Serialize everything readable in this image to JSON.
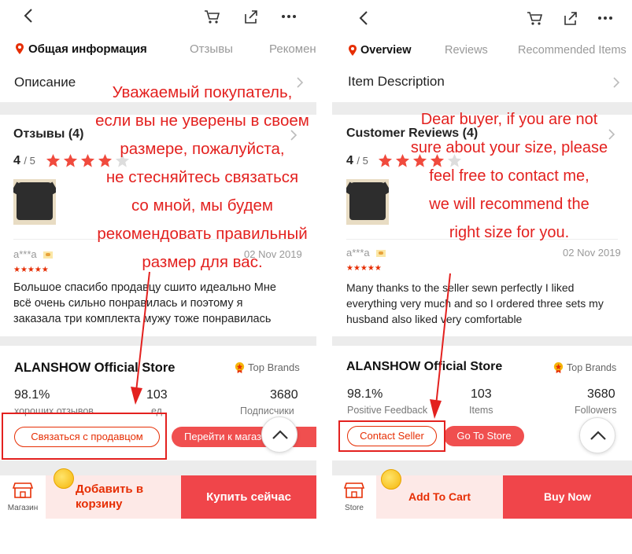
{
  "left": {
    "tabs": [
      "Общая информация",
      "Отзывы",
      "Рекомен"
    ],
    "description": "Описание",
    "reviews_title": "Отзывы (4)",
    "rating": "4",
    "rating_of": "/ 5",
    "reviewer": "a***a",
    "review_date": "02 Nov 2019",
    "review_text": [
      "Большое спасибо продавцу сшито идеально Мне",
      "всё очень сильно понравилась и поэтому я",
      "заказала три комплекта мужу тоже понравилась"
    ],
    "store_name": "ALANSHOW Official Store",
    "top_brands": "Top Brands",
    "stats": [
      {
        "value": "98.1%",
        "label": "хороших отзывов"
      },
      {
        "value": "103",
        "label": "ед."
      },
      {
        "value": "3680",
        "label": "Подписчики"
      }
    ],
    "contact_seller": "Связаться с продавцом",
    "go_to_store": "Перейти к магазину",
    "store_tab": "Магазин",
    "add_to_cart": "Добавить в корзину",
    "buy_now": "Купить сейчас",
    "overlay": [
      "Уважаемый покупатель,",
      "если вы не уверены в своем",
      "размере, пожалуйста,",
      "не стесняйтесь связаться",
      "со мной, мы будем",
      "рекомендовать правильный",
      "размер для вас."
    ]
  },
  "right": {
    "tabs": [
      "Overview",
      "Reviews",
      "Recommended Items"
    ],
    "description": "Item Description",
    "reviews_title": "Customer Reviews (4)",
    "rating": "4",
    "rating_of": "/ 5",
    "reviewer": "a***a",
    "review_date": "02 Nov 2019",
    "review_text": [
      "Many thanks to the seller sewn perfectly I liked",
      "everything very much and so I ordered three sets my",
      "husband also liked very comfortable"
    ],
    "store_name": "ALANSHOW Official Store",
    "top_brands": "Top Brands",
    "stats": [
      {
        "value": "98.1%",
        "label": "Positive Feedback"
      },
      {
        "value": "103",
        "label": "Items"
      },
      {
        "value": "3680",
        "label": "Followers"
      }
    ],
    "contact_seller": "Contact Seller",
    "go_to_store": "Go To Store",
    "store_tab": "Store",
    "add_to_cart": "Add To Cart",
    "buy_now": "Buy Now",
    "overlay": [
      "Dear buyer, if you are not",
      "sure about your size, please",
      "feel free to contact me,",
      "we will recommend the",
      "right size for you."
    ]
  },
  "colors": {
    "accent": "#e62e04",
    "annotation": "#e3211f",
    "buy_now_bg": "#f0454a",
    "add_cart_bg": "#fde9e7",
    "star": "#f04a3d"
  },
  "icons": [
    "back-arrow-icon",
    "cart-icon",
    "share-icon",
    "more-icon",
    "location-pin-icon",
    "chevron-right-icon",
    "star-icon",
    "flag-icon",
    "top-brands-badge-icon",
    "chevron-up-icon",
    "store-icon",
    "coin-icon"
  ]
}
